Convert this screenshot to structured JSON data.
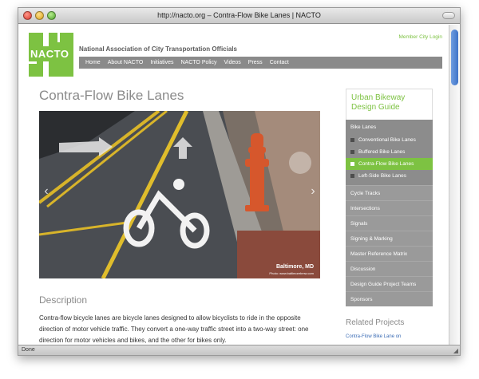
{
  "window": {
    "title": "http://nacto.org – Contra-Flow Bike Lanes | NACTO",
    "status": "Done"
  },
  "site": {
    "logo_text": "NACTO",
    "org_name": "National Association of City Transportation Officials",
    "member_login": "Member City Login",
    "nav": [
      "Home",
      "About NACTO",
      "Initiatives",
      "NACTO Policy",
      "Videos",
      "Press",
      "Contact"
    ]
  },
  "page": {
    "title": "Contra-Flow Bike Lanes",
    "photo_city": "Baltimore, MD",
    "photo_credit": "Photo: www.baltimorebmw.com",
    "description_heading": "Description",
    "description_text": "Contra-flow bicycle lanes are bicycle lanes designed to allow bicyclists to ride in the opposite direction of motor vehicle traffic. They convert a one-way traffic street into a two-way street: one direction for motor vehicles and bikes, and the other for bikes only."
  },
  "sidebar": {
    "guide_title_1": "Urban Bikeway",
    "guide_title_2": "Design Guide",
    "section_head": "Bike Lanes",
    "sub_items": [
      {
        "label": "Conventional Bike Lanes",
        "active": false
      },
      {
        "label": "Buffered Bike Lanes",
        "active": false
      },
      {
        "label": "Contra-Flow Bike Lanes",
        "active": true
      },
      {
        "label": "Left-Side Bike Lanes",
        "active": false
      }
    ],
    "items": [
      "Cycle Tracks",
      "Intersections",
      "Signals",
      "Signing & Marking",
      "Master Reference Matrix",
      "Discussion",
      "Design Guide Project Teams",
      "Sponsors"
    ],
    "related_title": "Related Projects",
    "related_link": "Contra-Flow Bike Lane on"
  },
  "colors": {
    "brand_green": "#7dc242",
    "nav_gray": "#8a8a8a",
    "link_blue": "#3b6cb5"
  }
}
